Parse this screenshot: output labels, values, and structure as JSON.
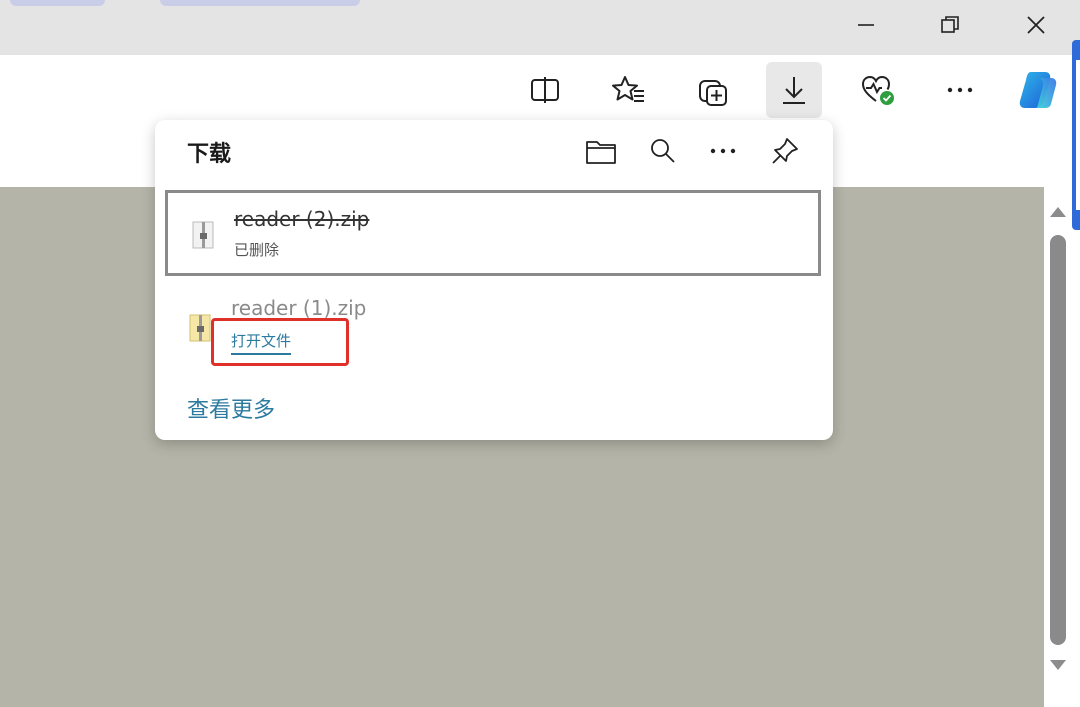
{
  "window": {
    "buttons": {
      "minimize": "minimize-icon",
      "restore": "restore-icon",
      "close": "close-icon"
    }
  },
  "toolbar": {
    "icons": [
      "split-screen-icon",
      "favorites-icon",
      "collections-icon",
      "download-icon",
      "browser-essentials-icon",
      "more-icon",
      "copilot-icon"
    ]
  },
  "downloads": {
    "title": "下载",
    "actions": [
      "folder-icon",
      "search-icon",
      "more-icon",
      "pin-icon"
    ],
    "items": [
      {
        "name": "reader (2).zip",
        "status": "已删除"
      },
      {
        "name": "reader (1).zip",
        "action": "打开文件"
      }
    ],
    "see_more": "查看更多"
  },
  "colors": {
    "link": "#2d7aa0",
    "highlight": "#e0302a",
    "health_badge": "#2e9e3f"
  }
}
